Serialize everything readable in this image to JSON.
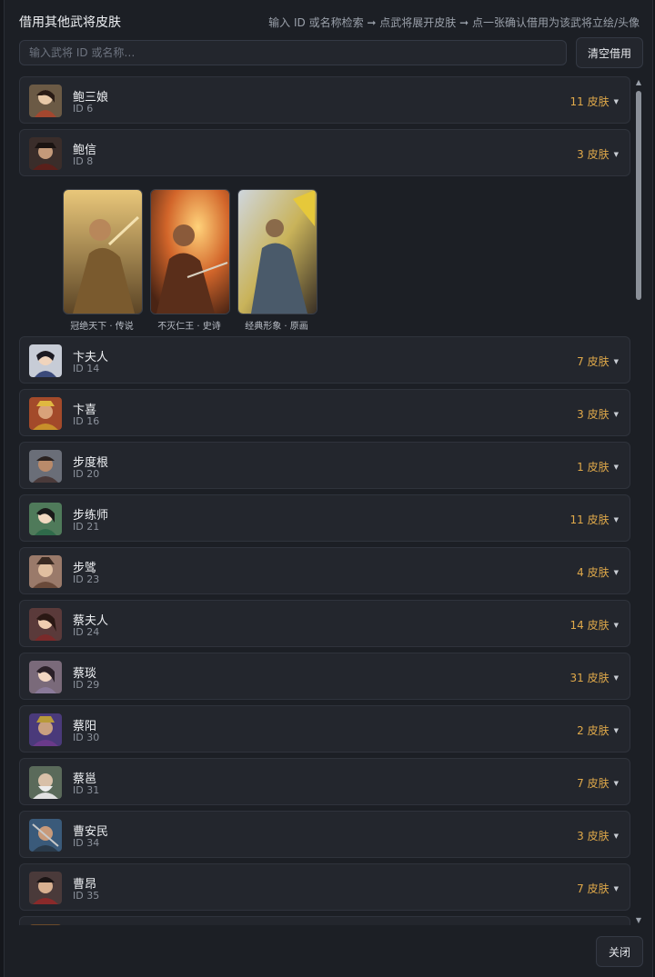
{
  "header": {
    "title": "借用其他武将皮肤",
    "hint": "输入 ID 或名称检索 ➞ 点武将展开皮肤 ➞ 点一张确认借用为该武将立绘/头像"
  },
  "search": {
    "placeholder": "输入武将 ID 或名称…",
    "value": ""
  },
  "clear_label": "清空借用",
  "close_label": "关闭",
  "generals": [
    {
      "name": "鲍三娘",
      "id": "ID 6",
      "skins": "11 皮肤"
    },
    {
      "name": "鲍信",
      "id": "ID 8",
      "skins": "3 皮肤"
    },
    {
      "name": "卞夫人",
      "id": "ID 14",
      "skins": "7 皮肤"
    },
    {
      "name": "卞喜",
      "id": "ID 16",
      "skins": "3 皮肤"
    },
    {
      "name": "步度根",
      "id": "ID 20",
      "skins": "1 皮肤"
    },
    {
      "name": "步练师",
      "id": "ID 21",
      "skins": "11 皮肤"
    },
    {
      "name": "步骘",
      "id": "ID 23",
      "skins": "4 皮肤"
    },
    {
      "name": "蔡夫人",
      "id": "ID 24",
      "skins": "14 皮肤"
    },
    {
      "name": "蔡琰",
      "id": "ID 29",
      "skins": "31 皮肤"
    },
    {
      "name": "蔡阳",
      "id": "ID 30",
      "skins": "2 皮肤"
    },
    {
      "name": "蔡邕",
      "id": "ID 31",
      "skins": "7 皮肤"
    },
    {
      "name": "曹安民",
      "id": "ID 34",
      "skins": "3 皮肤"
    },
    {
      "name": "曹昂",
      "id": "ID 35",
      "skins": "7 皮肤"
    }
  ],
  "expanded_skins": [
    {
      "label": "冠绝天下 · 传说"
    },
    {
      "label": "不灭仁王 · 史诗"
    },
    {
      "label": "经典形象 · 原画"
    }
  ],
  "icons": {
    "expand": "caret-down-icon",
    "scroll_up": "arrow-up-icon",
    "scroll_down": "arrow-down-icon"
  },
  "colors": {
    "accent": "#e0a94a",
    "background": "#1c1f25",
    "row": "#23262d"
  }
}
